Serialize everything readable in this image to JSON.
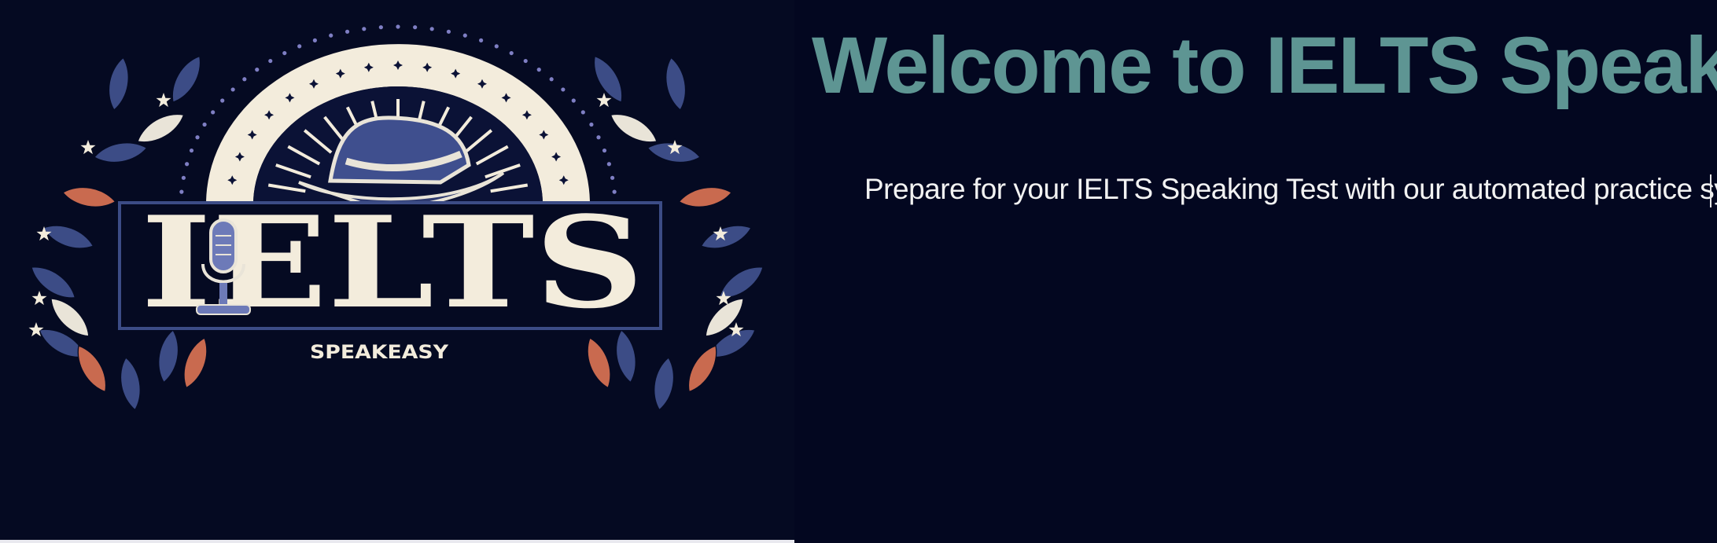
{
  "header": {
    "title": "Welcome to IELTS SpeakEasy",
    "subtitle": "Prepare for your IELTS Speaking Test with our automated practice system."
  },
  "logo": {
    "main_text": "IELTS",
    "sub_text": "SPEAKEASY",
    "icons": [
      "hat-icon",
      "microphone-icon",
      "leaf-icon",
      "star-icon"
    ]
  },
  "colors": {
    "background": "#030720",
    "title": "#5e9593",
    "subtitle": "#f2f2f2",
    "logo_cream": "#f3ecdc",
    "logo_navy": "#3c4c86",
    "logo_coral": "#c96a4f"
  }
}
